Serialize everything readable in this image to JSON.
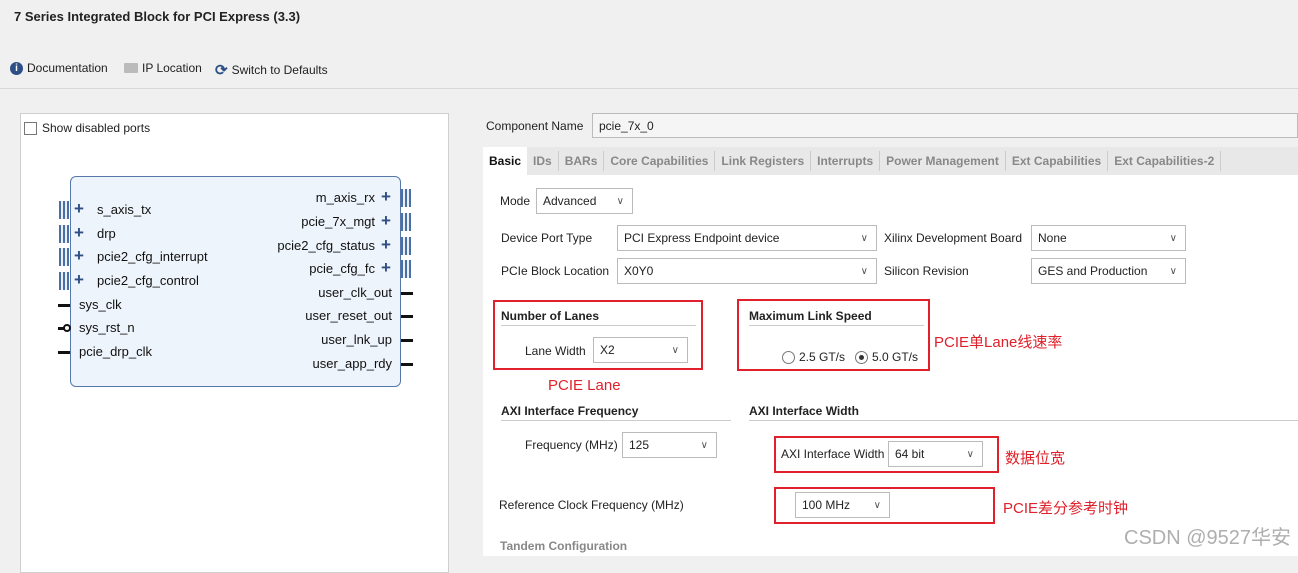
{
  "window": {
    "title": "7 Series Integrated Block for PCI Express (3.3)"
  },
  "toolbar": {
    "documentation": "Documentation",
    "ip_location": "IP Location",
    "switch_defaults": "Switch to Defaults"
  },
  "left": {
    "show_disabled_ports": "Show disabled ports",
    "left_ports": [
      "s_axis_tx",
      "drp",
      "pcie2_cfg_interrupt",
      "pcie2_cfg_control",
      "sys_clk",
      "sys_rst_n",
      "pcie_drp_clk"
    ],
    "right_ports": [
      "m_axis_rx",
      "pcie_7x_mgt",
      "pcie2_cfg_status",
      "pcie_cfg_fc",
      "user_clk_out",
      "user_reset_out",
      "user_lnk_up",
      "user_app_rdy"
    ]
  },
  "component": {
    "label": "Component Name",
    "value": "pcie_7x_0"
  },
  "tabs": [
    "Basic",
    "IDs",
    "BARs",
    "Core Capabilities",
    "Link Registers",
    "Interrupts",
    "Power Management",
    "Ext Capabilities",
    "Ext Capabilities-2"
  ],
  "basic": {
    "mode_label": "Mode",
    "mode": "Advanced",
    "device_port_type_label": "Device Port Type",
    "device_port_type": "PCI Express Endpoint device",
    "dev_board_label": "Xilinx Development Board",
    "dev_board": "None",
    "block_location_label": "PCIe Block Location",
    "block_location": "X0Y0",
    "silicon_label": "Silicon Revision",
    "silicon": "GES and Production",
    "lanes_title": "Number of Lanes",
    "lane_width_label": "Lane Width",
    "lane_width": "X2",
    "speed_title": "Maximum Link Speed",
    "speed_opt1": "2.5 GT/s",
    "speed_opt2": "5.0 GT/s",
    "speed_selected": "5.0 GT/s",
    "axi_freq_title": "AXI Interface Frequency",
    "freq_label": "Frequency (MHz)",
    "freq": "125",
    "axi_width_title": "AXI Interface Width",
    "axi_width_label": "AXI Interface Width",
    "axi_width": "64 bit",
    "ref_clk_label": "Reference Clock Frequency (MHz)",
    "ref_clk": "100 MHz",
    "tandem_title": "Tandem Configuration"
  },
  "annotations": {
    "lane": "PCIE Lane",
    "speed": "PCIE单Lane线速率",
    "width": "数据位宽",
    "refclk": "PCIE差分参考时钟"
  },
  "watermark": "CSDN @9527华安",
  "colors": {
    "annotation": "#e0202a",
    "block_border": "#5577aa",
    "bus": "#4a6fa5"
  }
}
